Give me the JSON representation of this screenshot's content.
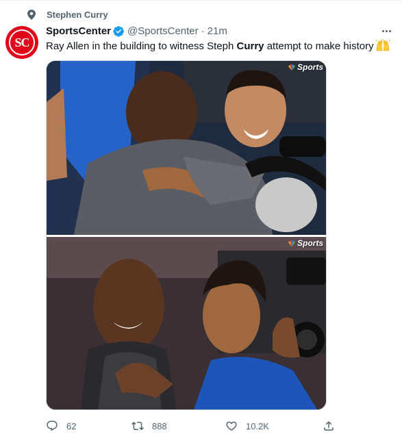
{
  "social_context": {
    "label": "Stephen Curry",
    "icon": "pin-icon"
  },
  "author": {
    "name": "SportsCenter",
    "handle": "@SportsCenter",
    "separator": "·",
    "time": "21m",
    "avatar_text": "SC",
    "avatar_color": "#e2061b",
    "verified_color": "#1d9bf0"
  },
  "tweet": {
    "text_before": "Ray Allen in the building to witness Steph ",
    "text_bold": "Curry",
    "text_after": " attempt to make history",
    "emoji": "raising-hands-emoji"
  },
  "media": {
    "watermark": "Sports",
    "photos": [
      {
        "description_icon": "photo-hug"
      },
      {
        "description_icon": "photo-smile"
      }
    ]
  },
  "actions": {
    "reply_count": "62",
    "retweet_count": "888",
    "like_count": "10.2K"
  },
  "colors": {
    "secondary_text": "#536471",
    "border": "#cfd9de"
  }
}
